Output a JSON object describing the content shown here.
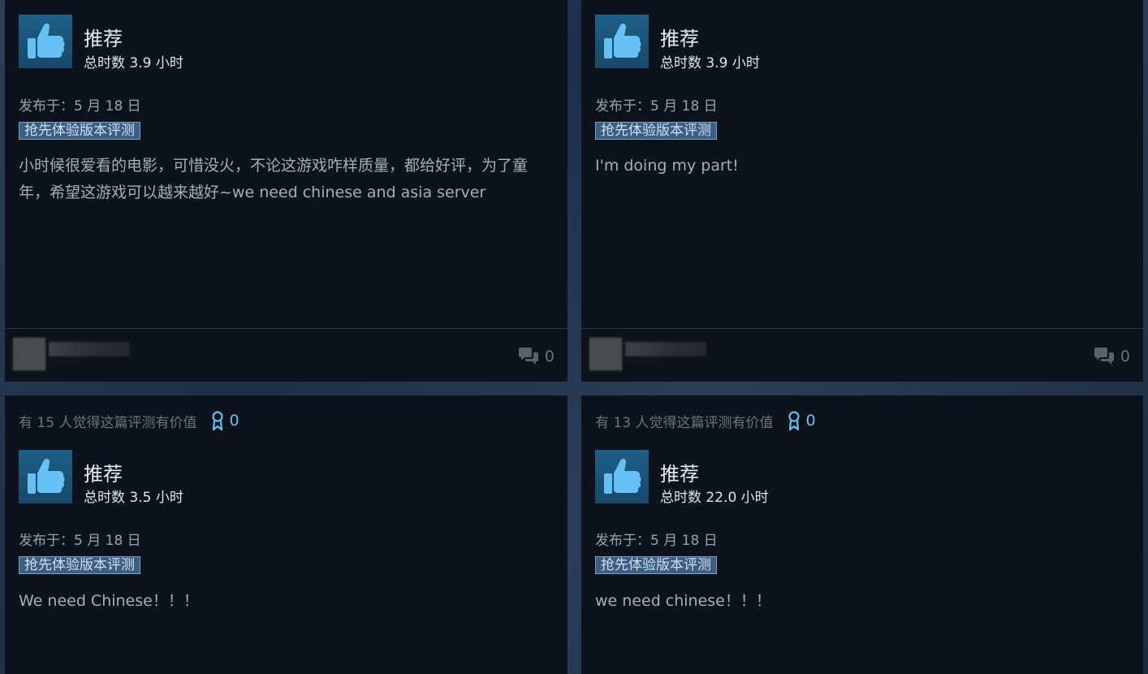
{
  "reviews": [
    {
      "helpful_text": "",
      "awards": "",
      "recommendation": "推荐",
      "hours": "总时数 3.9 小时",
      "posted": "发布于：5 月 18 日",
      "badge": "抢先体验版本评测",
      "content": "小时候很爱看的电影，可惜没火，不论这游戏咋样质量，都给好评，为了童年，希望这游戏可以越来越好~we need chinese and asia server",
      "comment_count": "0"
    },
    {
      "helpful_text": "",
      "awards": "",
      "recommendation": "推荐",
      "hours": "总时数 3.9 小时",
      "posted": "发布于：5 月 18 日",
      "badge": "抢先体验版本评测",
      "content": "I'm doing my part!",
      "comment_count": "0"
    },
    {
      "helpful_text": "有 15 人觉得这篇评测有价值",
      "awards": "0",
      "recommendation": "推荐",
      "hours": "总时数 3.5 小时",
      "posted": "发布于：5 月 18 日",
      "badge": "抢先体验版本评测",
      "content": "We need Chinese！！！",
      "comment_count": ""
    },
    {
      "helpful_text": "有 13 人觉得这篇评测有价值",
      "awards": "0",
      "recommendation": "推荐",
      "hours": "总时数 22.0 小时",
      "posted": "发布于：5 月 18 日",
      "badge": "抢先体验版本评测",
      "content": "we need chinese！！！",
      "comment_count": ""
    }
  ],
  "icons": {
    "recommend": "thumbs-up-icon",
    "award": "award-ribbon-icon",
    "comments": "comment-bubbles-icon"
  },
  "colors": {
    "card_bg": "#0d121b",
    "accent": "#66c0f4",
    "badge_bg": "#3c5e82"
  }
}
